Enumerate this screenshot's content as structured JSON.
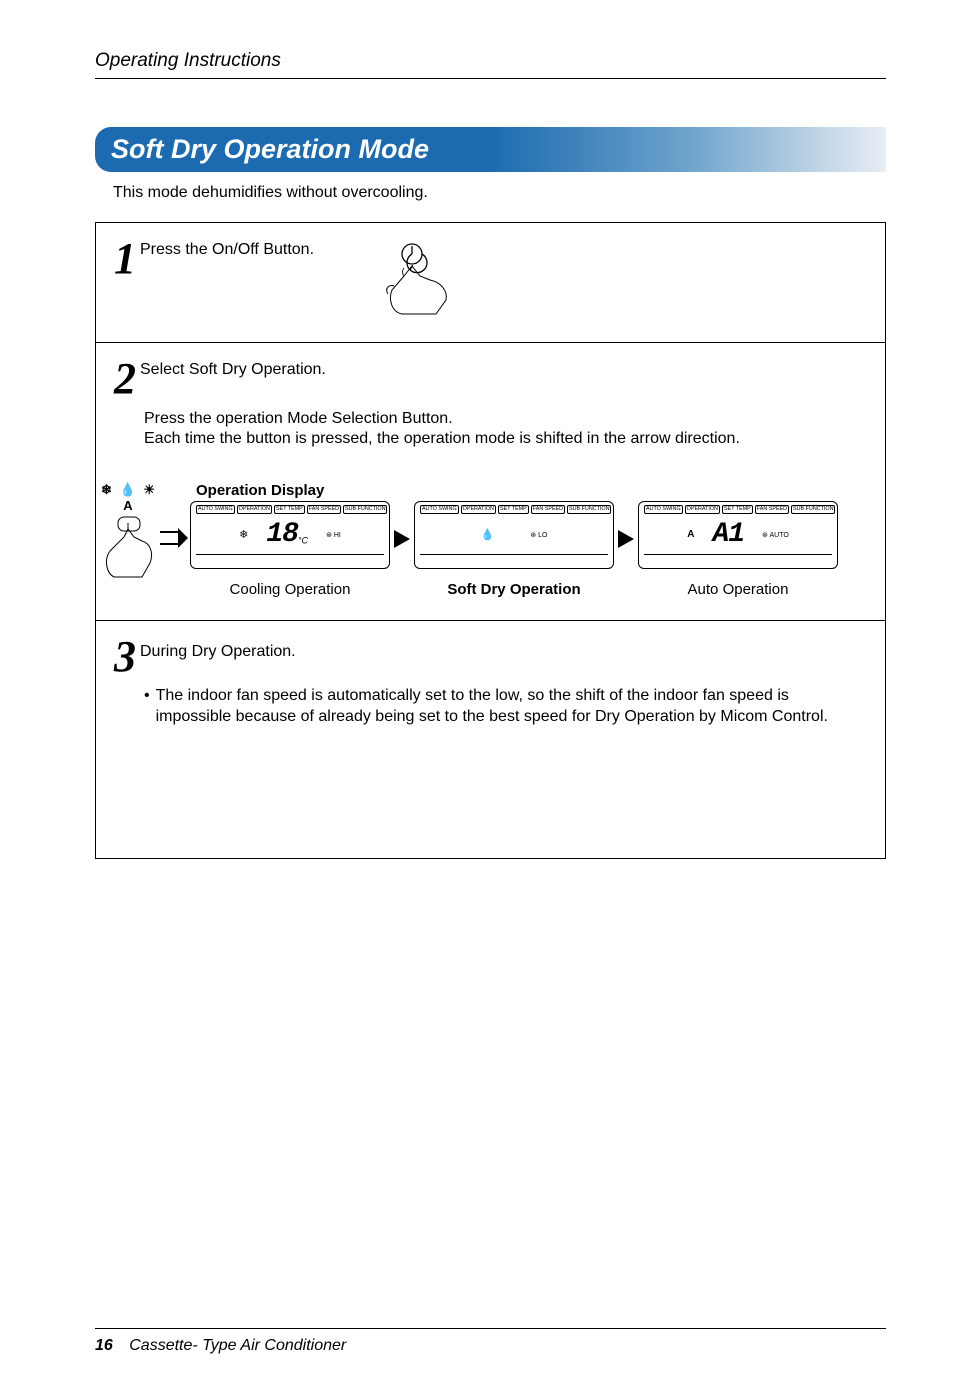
{
  "header": {
    "title": "Operating Instructions"
  },
  "section": {
    "title": "Soft Dry Operation Mode",
    "intro": "This mode dehumidifies without overcooling."
  },
  "steps": {
    "s1": {
      "num": "1",
      "title": "Press the On/Off Button."
    },
    "s2": {
      "num": "2",
      "title": "Select Soft Dry Operation.",
      "line1": "Press the operation Mode Selection Button.",
      "line2": "Each time the button is pressed, the operation mode is shifted in the arrow direction.",
      "mode_icons": "❄ 💧 ☀ A",
      "display_label": "Operation Display",
      "lcd_tabs": [
        "AUTO SWING",
        "OPERATION",
        "SET TEMP",
        "FAN SPEED",
        "SUB FUNCTION"
      ],
      "cols": [
        {
          "icon": "❄",
          "seg": "18",
          "seg_sub": "°C",
          "fan": "⊛ HI",
          "caption": "Cooling Operation",
          "bold": false
        },
        {
          "icon": "💧",
          "seg": "",
          "seg_sub": "",
          "fan": "⊛ LO",
          "caption": "Soft Dry Operation",
          "bold": true
        },
        {
          "icon": "A",
          "seg": "A1",
          "seg_sub": "",
          "fan": "⊛ AUTO",
          "caption": "Auto Operation",
          "bold": false
        }
      ]
    },
    "s3": {
      "num": "3",
      "title": "During Dry Operation.",
      "bullet": "The indoor fan speed is automatically set to the low, so the shift of the indoor fan speed is impossible because of already being set to the best speed for Dry Operation by Micom Control."
    }
  },
  "footer": {
    "page": "16",
    "text": "Cassette- Type Air Conditioner"
  }
}
